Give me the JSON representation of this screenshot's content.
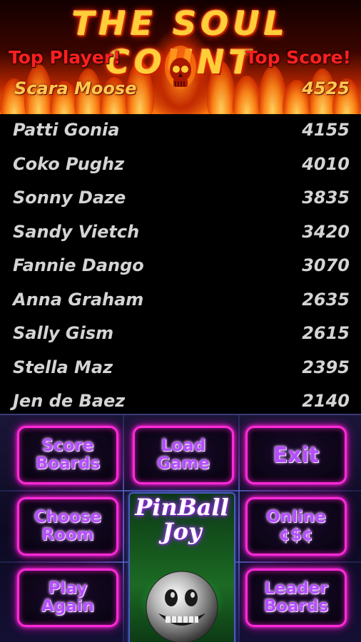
{
  "header": {
    "title": "THE SOUL COUNT",
    "top_player_label": "Top Player!",
    "top_score_label": "Top Score!",
    "top_entry": {
      "name": "Scara Moose",
      "score": "4525"
    }
  },
  "scores": [
    {
      "name": "Patti Gonia",
      "score": "4155"
    },
    {
      "name": "Coko Pughz",
      "score": "4010"
    },
    {
      "name": "Sonny Daze",
      "score": "3835"
    },
    {
      "name": "Sandy Vietch",
      "score": "3420"
    },
    {
      "name": "Fannie Dango",
      "score": "3070"
    },
    {
      "name": "Anna Graham",
      "score": "2635"
    },
    {
      "name": "Sally Gism",
      "score": "2615"
    },
    {
      "name": "Stella Maz",
      "score": "2395"
    },
    {
      "name": "Jen de Baez",
      "score": "2140"
    }
  ],
  "menu": {
    "score_boards": "Score\nBoards",
    "load_game": "Load\nGame",
    "exit": "Exit",
    "choose_room": "Choose\nRoom",
    "online_csc": "Online\n¢$¢",
    "play_again": "Play\nAgain",
    "leader_boards": "Leader\nBoards",
    "logo": "PinBall\nJoy"
  },
  "colors": {
    "neon_pink": "#ff2ad8",
    "neon_purple": "#b54dff",
    "fire_red": "#ff2020",
    "fire_gold": "#ffc850",
    "list_text": "#d4d4d4"
  },
  "icons": {
    "skull": "flaming-skull-icon",
    "ball": "pinball-face-icon"
  }
}
